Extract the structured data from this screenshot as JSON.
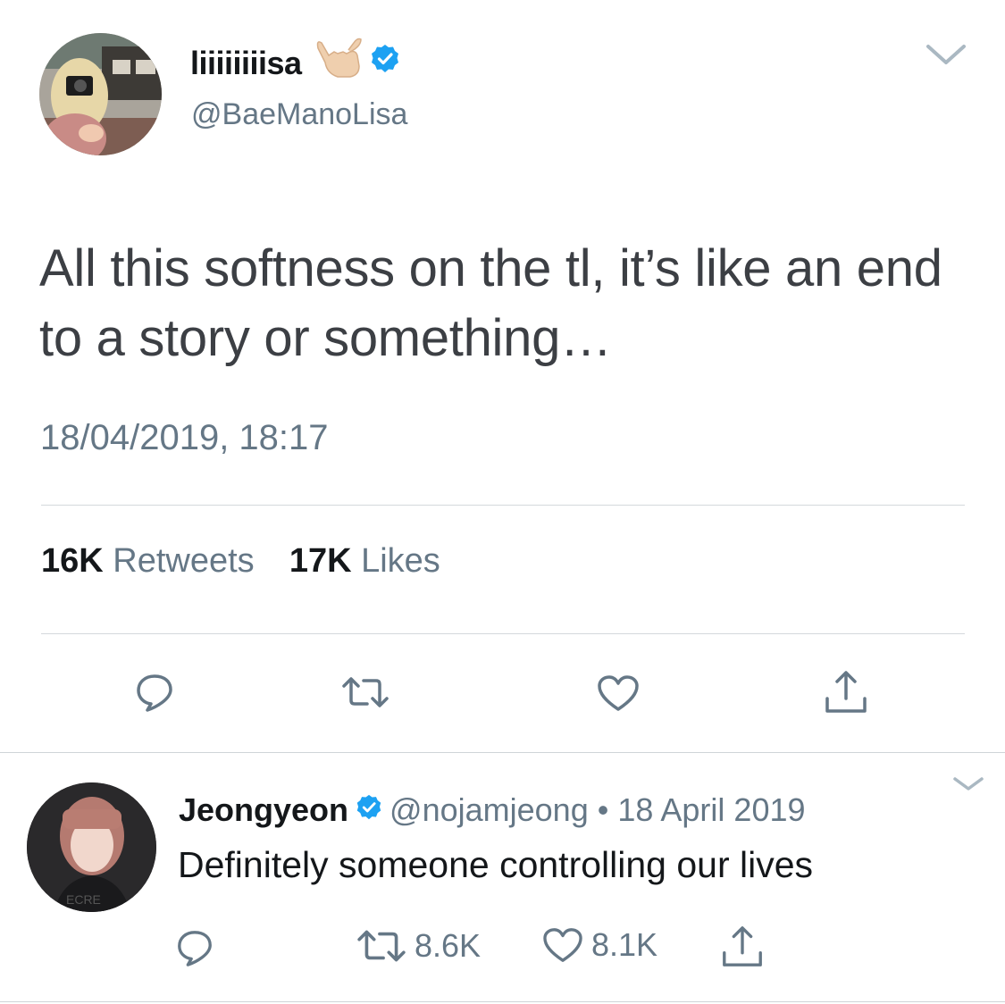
{
  "main_tweet": {
    "display_name": "liiiiiiiisa",
    "handle": "@BaeManoLisa",
    "text": "All this softness on the tl, it’s like an end to a story or something…",
    "timestamp": "18/04/2019, 18:17",
    "retweets_count": "16K",
    "retweets_label": "Retweets",
    "likes_count": "17K",
    "likes_label": "Likes",
    "icons": [
      "reply-icon",
      "retweet-icon",
      "like-icon",
      "share-icon",
      "chevron-down-icon",
      "verified-icon",
      "call-me-hand-emoji"
    ]
  },
  "reply_tweet": {
    "display_name": "Jeongyeon",
    "handle": "@nojamjeong",
    "separator": "•",
    "date": "18 April 2019",
    "text": "Definitely someone controlling our lives",
    "retweets_count": "8.6K",
    "likes_count": "8.1K"
  },
  "colors": {
    "text_primary": "#14171a",
    "text_secondary": "#657786",
    "verified_blue": "#1da1f2",
    "divider": "#d4d8dc"
  }
}
